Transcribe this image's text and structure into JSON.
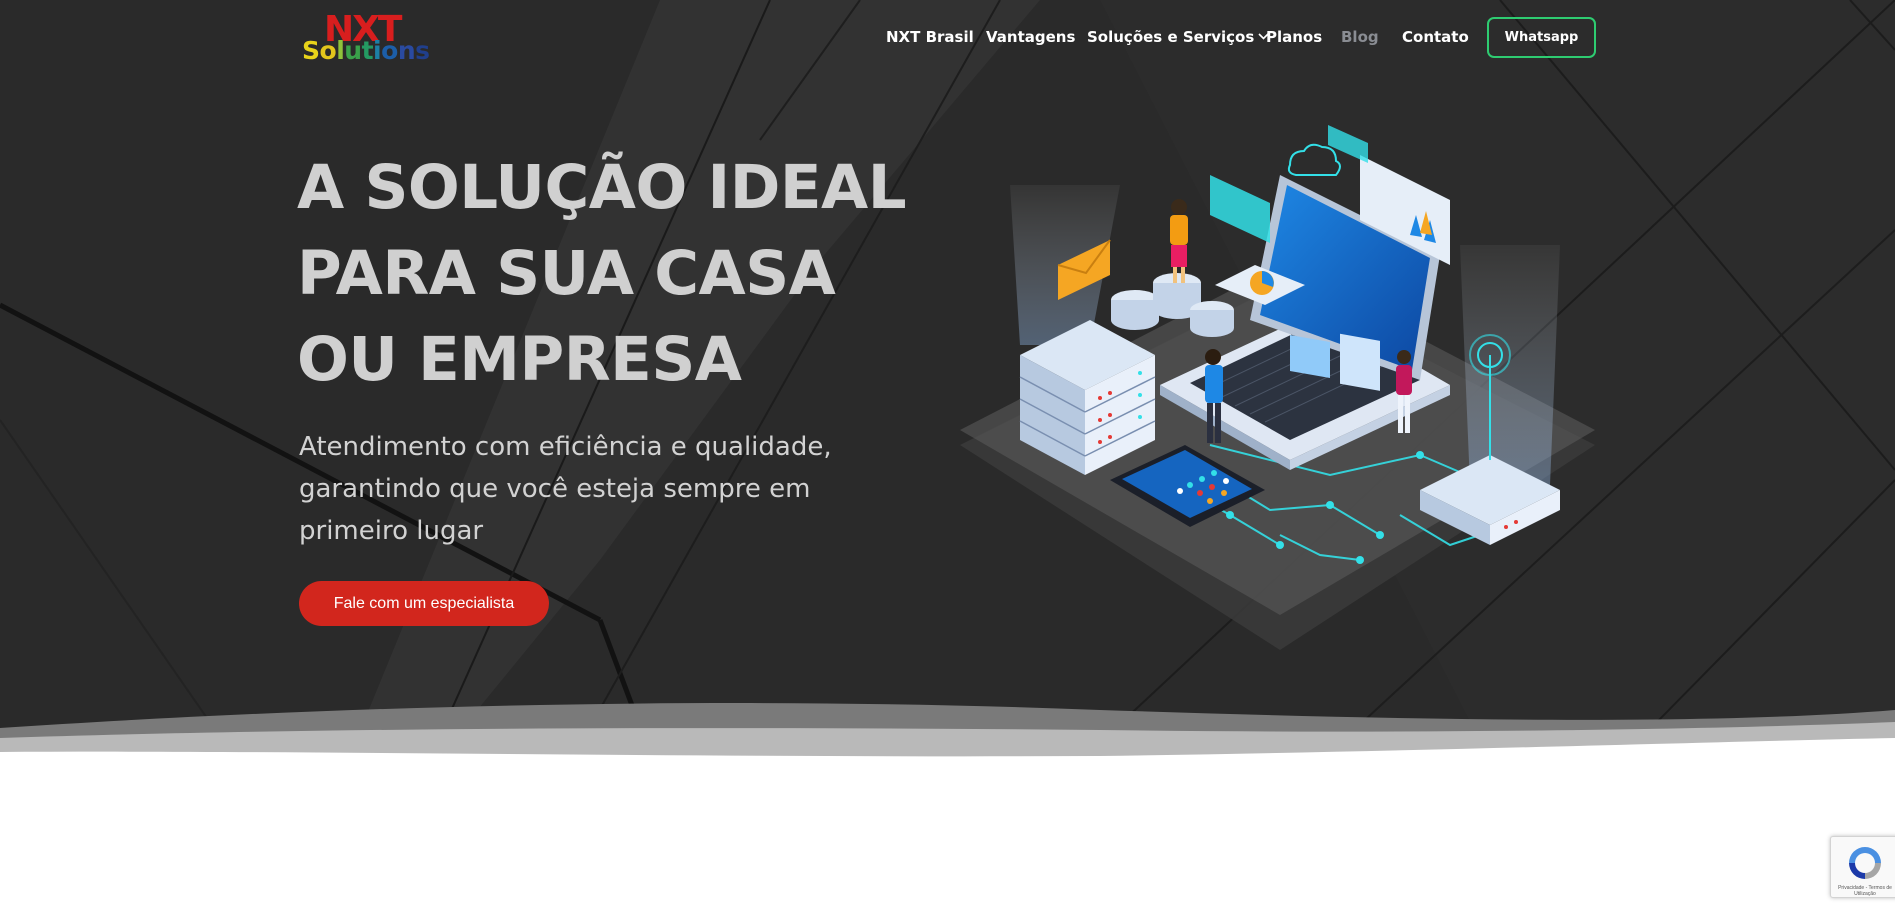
{
  "brand": {
    "logo_top": "NXT",
    "logo_bottom": "Solutions"
  },
  "nav": {
    "items": [
      {
        "label": "NXT Brasil"
      },
      {
        "label": "Vantagens"
      },
      {
        "label": "Soluções e Serviços"
      },
      {
        "label": "Planos"
      },
      {
        "label": "Blog"
      },
      {
        "label": "Contato"
      }
    ],
    "whatsapp_label": "Whatsapp"
  },
  "hero": {
    "headline": "A SOLUÇÃO IDEAL PARA SUA CASA OU EMPRESA",
    "subtitle": "Atendimento com eficiência e qualidade, garantindo que você esteja sempre em primeiro lugar",
    "cta_label": "Fale com um especialista"
  },
  "recaptcha": {
    "text": "Privacidade - Termos de Utilização"
  },
  "colors": {
    "hero_bg": "#2a2a2a",
    "cta": "#d2261d",
    "whatsapp_border": "#2ecc71",
    "logo_red": "#d81e1e",
    "accent_cyan": "#33e0e8"
  },
  "icons": {
    "dropdown": "chevron-down-icon",
    "recaptcha": "recaptcha-icon"
  }
}
